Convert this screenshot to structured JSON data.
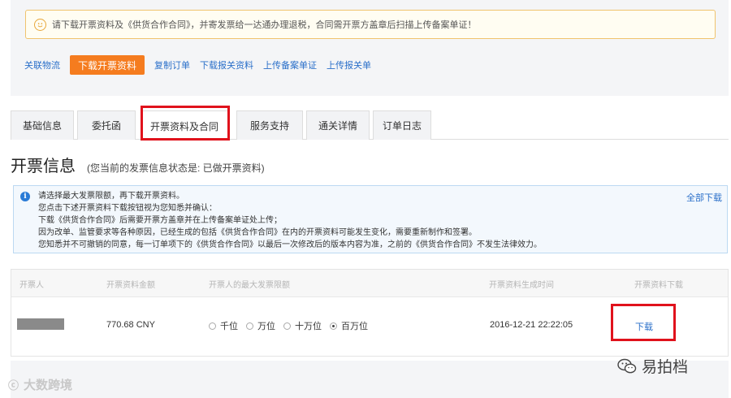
{
  "notice": {
    "text": "请下载开票资料及《供货合作合同》，并寄发票给一达通办理退税，合同需开票方盖章后扫描上传备案单证！"
  },
  "actions": {
    "related_logistics": "关联物流",
    "download_invoice": "下载开票资料",
    "copy_order": "复制订单",
    "download_customs": "下载报关资料",
    "upload_filing": "上传备案单证",
    "upload_declaration": "上传报关单"
  },
  "tabs": [
    {
      "label": "基础信息"
    },
    {
      "label": "委托函"
    },
    {
      "label": "开票资料及合同"
    },
    {
      "label": "服务支持"
    },
    {
      "label": "通关详情"
    },
    {
      "label": "订单日志"
    }
  ],
  "section": {
    "title": "开票信息",
    "status": "(您当前的发票信息状态是: 已做开票资料)"
  },
  "info": {
    "lines": [
      "请选择最大发票限额，再下载开票资料。",
      "您点击下述开票资料下载按钮视为您知悉并确认：",
      "下载《供货合作合同》后需要开票方盖章并在上传备案单证处上传；",
      "因为改单、监管要求等各种原因，已经生成的包括《供货合作合同》在内的开票资料可能发生变化，需要重新制作和签署。",
      "您知悉并不可撤销的同意，每一订单项下的《供货合作合同》以最后一次修改后的版本内容为准，之前的《供货合作合同》不发生法律效力。"
    ],
    "download_all": "全部下载"
  },
  "table": {
    "headers": {
      "issuer": "开票人",
      "amount": "开票资料金额",
      "limit": "开票人的最大发票限额",
      "time": "开票资料生成时间",
      "download": "开票资料下载"
    },
    "row": {
      "amount": "770.68 CNY",
      "limit_options": [
        "千位",
        "万位",
        "十万位",
        "百万位"
      ],
      "selected_limit": "百万位",
      "time": "2016-12-21 22:22:05",
      "download": "下载"
    }
  },
  "watermarks": {
    "left": "大数跨境",
    "right": "易拍档"
  },
  "colors": {
    "accent_orange": "#f57c1f",
    "link_blue": "#2a6fc9",
    "highlight_red": "#e0121c"
  }
}
